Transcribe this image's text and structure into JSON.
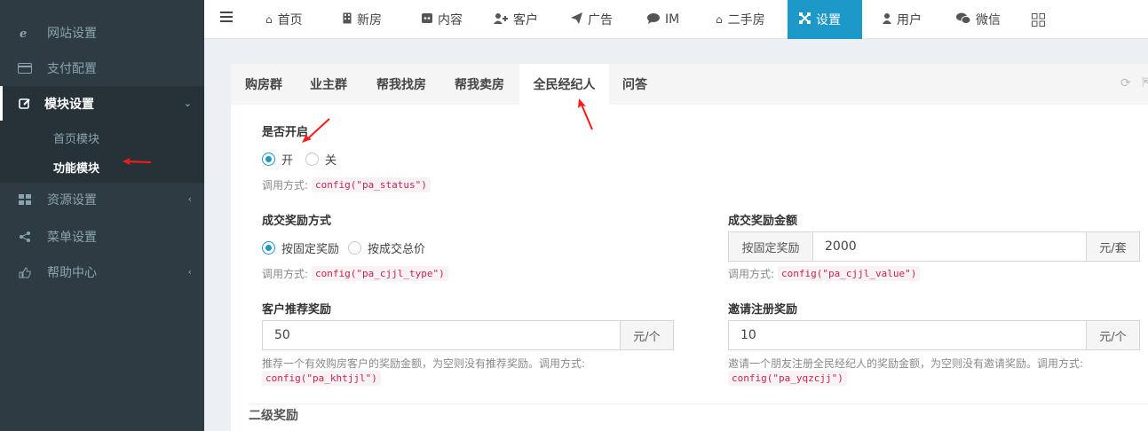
{
  "sidebar": {
    "items": [
      {
        "label": "网站设置",
        "icon": "ie-icon"
      },
      {
        "label": "支付配置",
        "icon": "credit-card-icon"
      },
      {
        "label": "模块设置",
        "icon": "edit-icon"
      },
      {
        "label": "资源设置",
        "icon": "th-large-icon"
      },
      {
        "label": "菜单设置",
        "icon": "share-icon"
      },
      {
        "label": "帮助中心",
        "icon": "thumbs-up-icon"
      }
    ],
    "submenu": [
      {
        "label": "首页模块"
      },
      {
        "label": "功能模块"
      }
    ]
  },
  "topnav": {
    "items": [
      {
        "label": "首页",
        "icon": "home-icon"
      },
      {
        "label": "新房",
        "icon": "building-icon"
      },
      {
        "label": "内容",
        "icon": "content-icon"
      },
      {
        "label": "客户",
        "icon": "user-plus-icon"
      },
      {
        "label": "广告",
        "icon": "paper-plane-icon"
      },
      {
        "label": "IM",
        "icon": "comment-icon"
      },
      {
        "label": "二手房",
        "icon": "home-icon"
      },
      {
        "label": "设置",
        "icon": "settings-icon"
      },
      {
        "label": "用户",
        "icon": "user-icon"
      },
      {
        "label": "微信",
        "icon": "wechat-icon"
      }
    ],
    "active": "设置"
  },
  "tabs": [
    {
      "label": "购房群"
    },
    {
      "label": "业主群"
    },
    {
      "label": "帮我找房"
    },
    {
      "label": "帮我卖房"
    },
    {
      "label": "全民经纪人"
    },
    {
      "label": "问答"
    }
  ],
  "form": {
    "call_prefix": "调用方式:",
    "status": {
      "label": "是否开启",
      "options": [
        "开",
        "关"
      ],
      "selected": "开",
      "code": "config(\"pa_status\")"
    },
    "reward_type": {
      "label": "成交奖励方式",
      "options": [
        "按固定奖励",
        "按成交总价"
      ],
      "selected": "按固定奖励",
      "code": "config(\"pa_cjjl_type\")"
    },
    "reward_value": {
      "label": "成交奖励金额",
      "prefix": "按固定奖励",
      "value": "2000",
      "suffix": "元/套",
      "code": "config(\"pa_cjjl_value\")"
    },
    "referral": {
      "label": "客户推荐奖励",
      "value": "50",
      "suffix": "元/个",
      "help": "推荐一个有效购房客户的奖励金额，为空则没有推荐奖励。调用方式:",
      "code": "config(\"pa_khtjjl\")"
    },
    "invite": {
      "label": "邀请注册奖励",
      "value": "10",
      "suffix": "元/个",
      "help": "邀请一个朋友注册全民经纪人的奖励金额，为空则没有邀请奖励。调用方式:",
      "code": "config(\"pa_yqzcjj\")"
    },
    "section_title": "二级奖励"
  },
  "colors": {
    "accent": "#1c98c9",
    "sidebar_bg": "#2f3b42",
    "annotation_arrow": "#ff0000"
  }
}
